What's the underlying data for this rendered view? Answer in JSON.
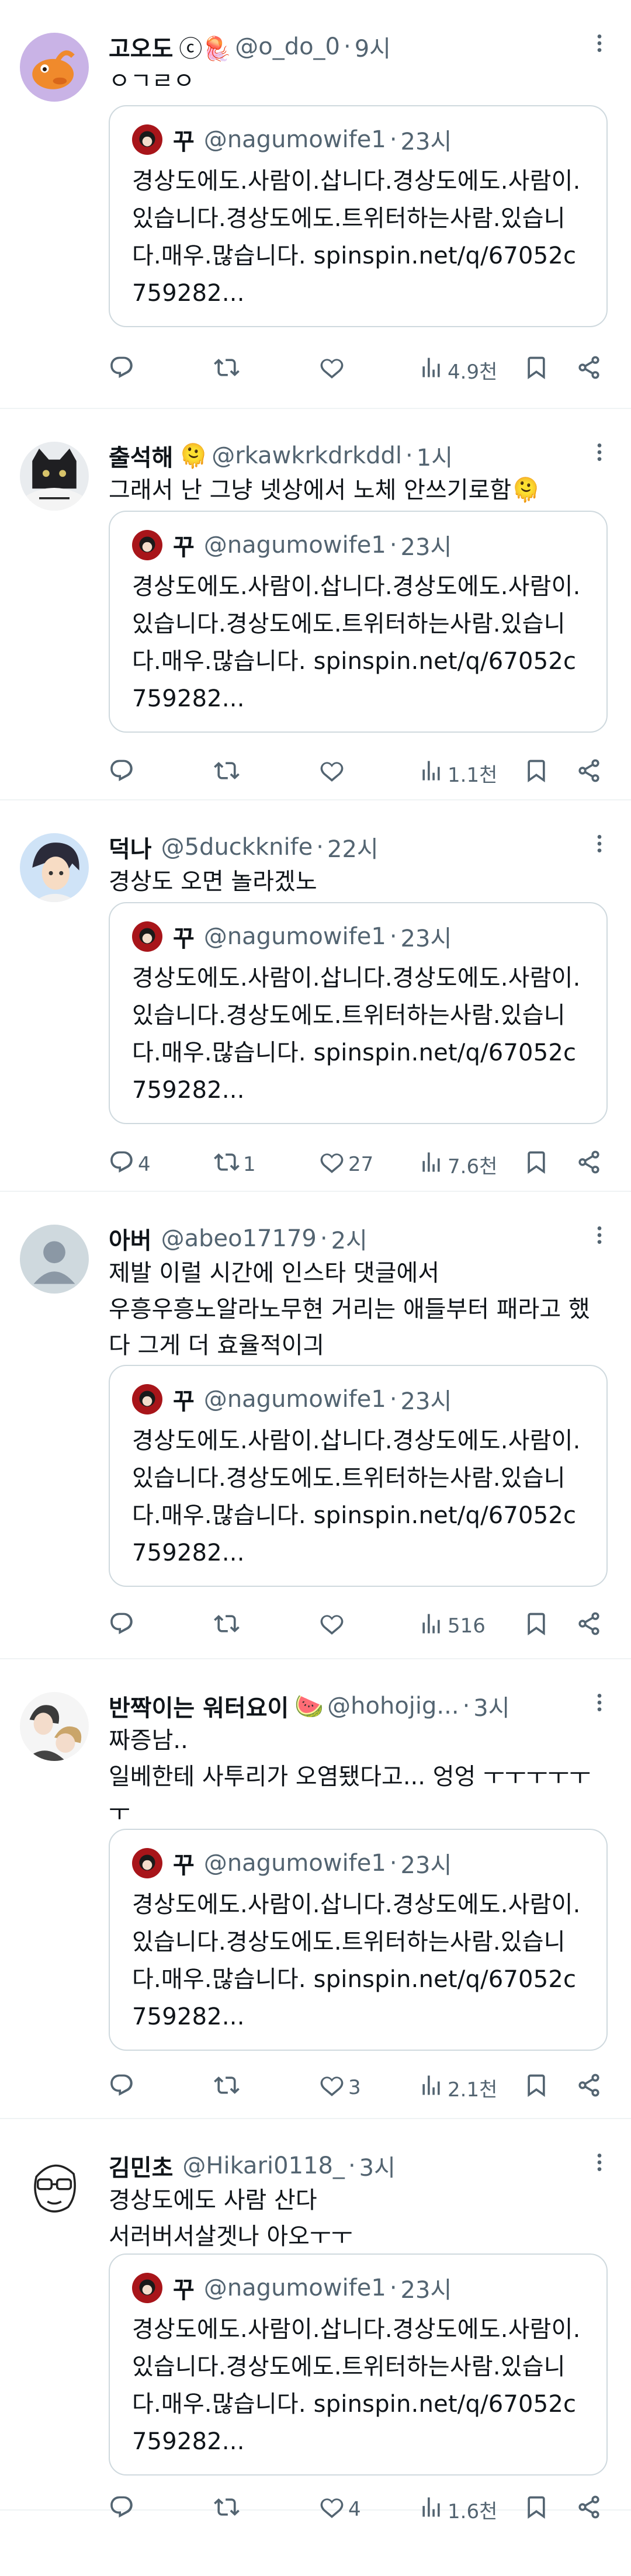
{
  "quoted": {
    "name": "꾸",
    "handle": "@nagumowife1",
    "time": "23시",
    "text": "경상도에도.사람이.삽니다.경상도에도.사람이.있습니다.경상도에도.트위터하는사람.있습니다.매우.많습니다. spinspin.net/q/67052c759282..."
  },
  "tweets": [
    {
      "name": "고오도",
      "badges": "ⓒ🪼",
      "handle": "@o_do_0",
      "time": "9시",
      "text": "ㅇㄱㄹㅇ",
      "replies": "",
      "retweets": "",
      "likes": "",
      "views": "4.9천"
    },
    {
      "name": "출석해",
      "badges": "🫠",
      "handle": "@rkawkrkdrkddl",
      "time": "1시",
      "text": "그래서 난 그냥 넷상에서 노체 안쓰기로함🫠",
      "replies": "",
      "retweets": "",
      "likes": "",
      "views": "1.1천"
    },
    {
      "name": "덕나",
      "badges": "",
      "handle": "@5duckknife",
      "time": "22시",
      "text": "경상도 오면 놀라겠노",
      "replies": "4",
      "retweets": "1",
      "likes": "27",
      "views": "7.6천"
    },
    {
      "name": "아버",
      "badges": "",
      "handle": "@abeo17179",
      "time": "2시",
      "text": "제발 이럴 시간에 인스타 댓글에서\n우흥우흥노알라노무현 거리는 애들부터 패라고 했다 그게 더 효율적이긔",
      "replies": "",
      "retweets": "",
      "likes": "",
      "views": "516"
    },
    {
      "name": "반짝이는 워터요이",
      "badges": "🍉",
      "handle": "@hohojig...",
      "time": "3시",
      "text": "짜증남..\n일베한테 사투리가 오염됐다고... 엉엉 ㅜㅜㅜㅜㅜㅜ",
      "replies": "",
      "retweets": "",
      "likes": "3",
      "views": "2.1천"
    },
    {
      "name": "김민초",
      "badges": "",
      "handle": "@Hikari0118_",
      "time": "3시",
      "text": "경상도에도 사람 산다\n서러버서살겟나 아오ㅜㅜ",
      "replies": "",
      "retweets": "",
      "likes": "4",
      "views": "1.6천"
    }
  ],
  "colors": {
    "text_primary": "#0f1419",
    "text_secondary": "#536471",
    "border": "#cfd9de",
    "divider": "#eff3f4"
  },
  "icons": {
    "reply": "reply-icon",
    "retweet": "retweet-icon",
    "like": "heart-icon",
    "views": "views-icon",
    "bookmark": "bookmark-icon",
    "share": "share-icon",
    "more": "more-icon"
  }
}
